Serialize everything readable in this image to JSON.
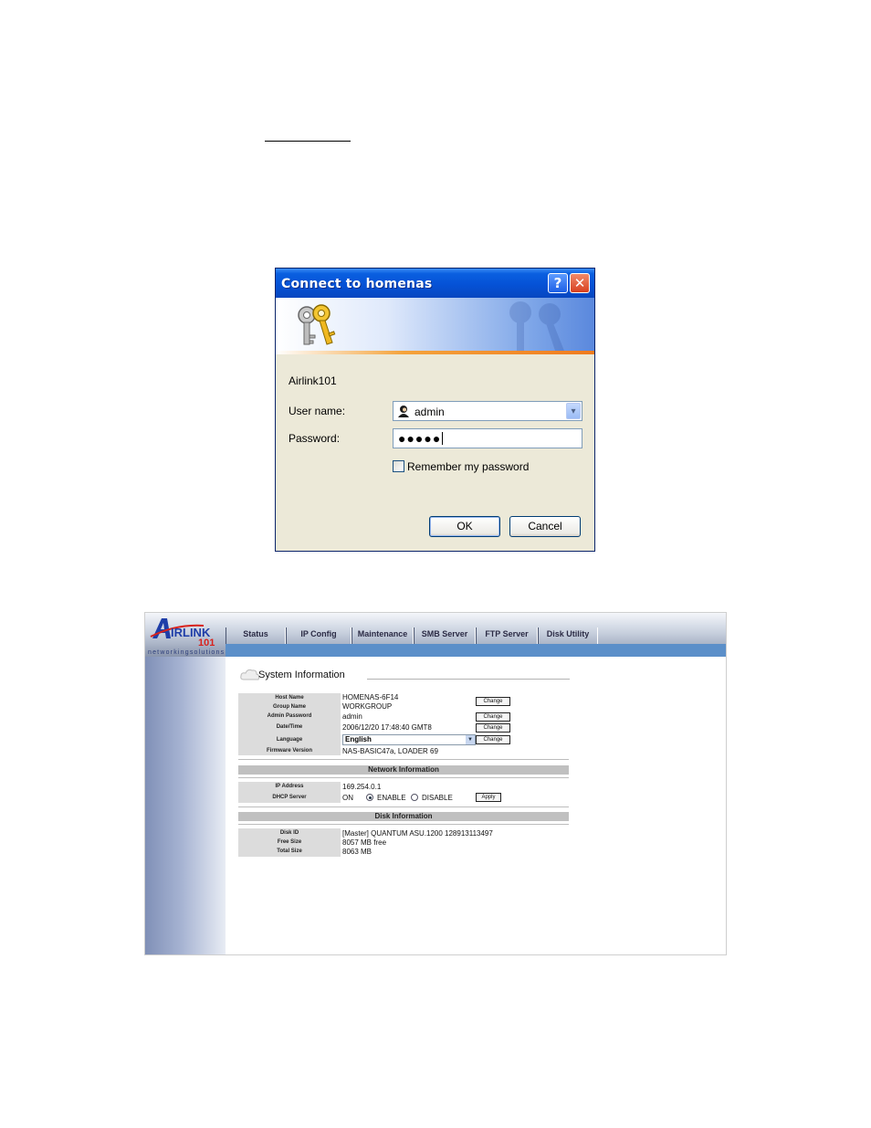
{
  "dialog": {
    "title": "Connect to homenas",
    "help_glyph": "?",
    "close_glyph": "✕",
    "realm": "Airlink101",
    "username_label": "User name:",
    "username_value": "admin",
    "password_label": "Password:",
    "password_value": "●●●●●",
    "remember_label": "Remember my password",
    "remember_checked": false,
    "ok_label": "OK",
    "cancel_label": "Cancel",
    "combo_arrow": "▾"
  },
  "web": {
    "tagline": "networkingsolutions",
    "logo_text": "AIRLINK",
    "logo_number": "101",
    "nav": [
      "Status",
      "IP Config",
      "Maintenance",
      "SMB Server",
      "FTP Server",
      "Disk Utility"
    ],
    "section_title": "System Information",
    "system_rows": [
      {
        "label": "Host Name",
        "value": "HOMENAS-6F14"
      },
      {
        "label": "Group Name",
        "value": "WORKGROUP"
      },
      {
        "label": "Admin Password",
        "value": "admin"
      },
      {
        "label": "Date/Time",
        "value": "2006/12/20 17:48:40 GMT8"
      },
      {
        "label": "Language",
        "value": ""
      },
      {
        "label": "Firmware Version",
        "value": "NAS-BASIC47a, LOADER 69"
      }
    ],
    "language_selected": "English",
    "change_label": "Change",
    "network_title": "Network Information",
    "ip_label": "IP Address",
    "ip_value": "169.254.0.1",
    "dhcp_label": "DHCP Server",
    "dhcp_on": "ON",
    "dhcp_enable": "ENABLE",
    "dhcp_disable": "DISABLE",
    "dhcp_selected": "enable",
    "apply_label": "Apply",
    "disk_title": "Disk Information",
    "disk_rows": [
      {
        "label": "Disk ID",
        "value": "[Master] QUANTUM ASU.1200 128913113497"
      },
      {
        "label": "Free Size",
        "value": "8057 MB free"
      },
      {
        "label": "Total Size",
        "value": "8063 MB"
      }
    ]
  }
}
